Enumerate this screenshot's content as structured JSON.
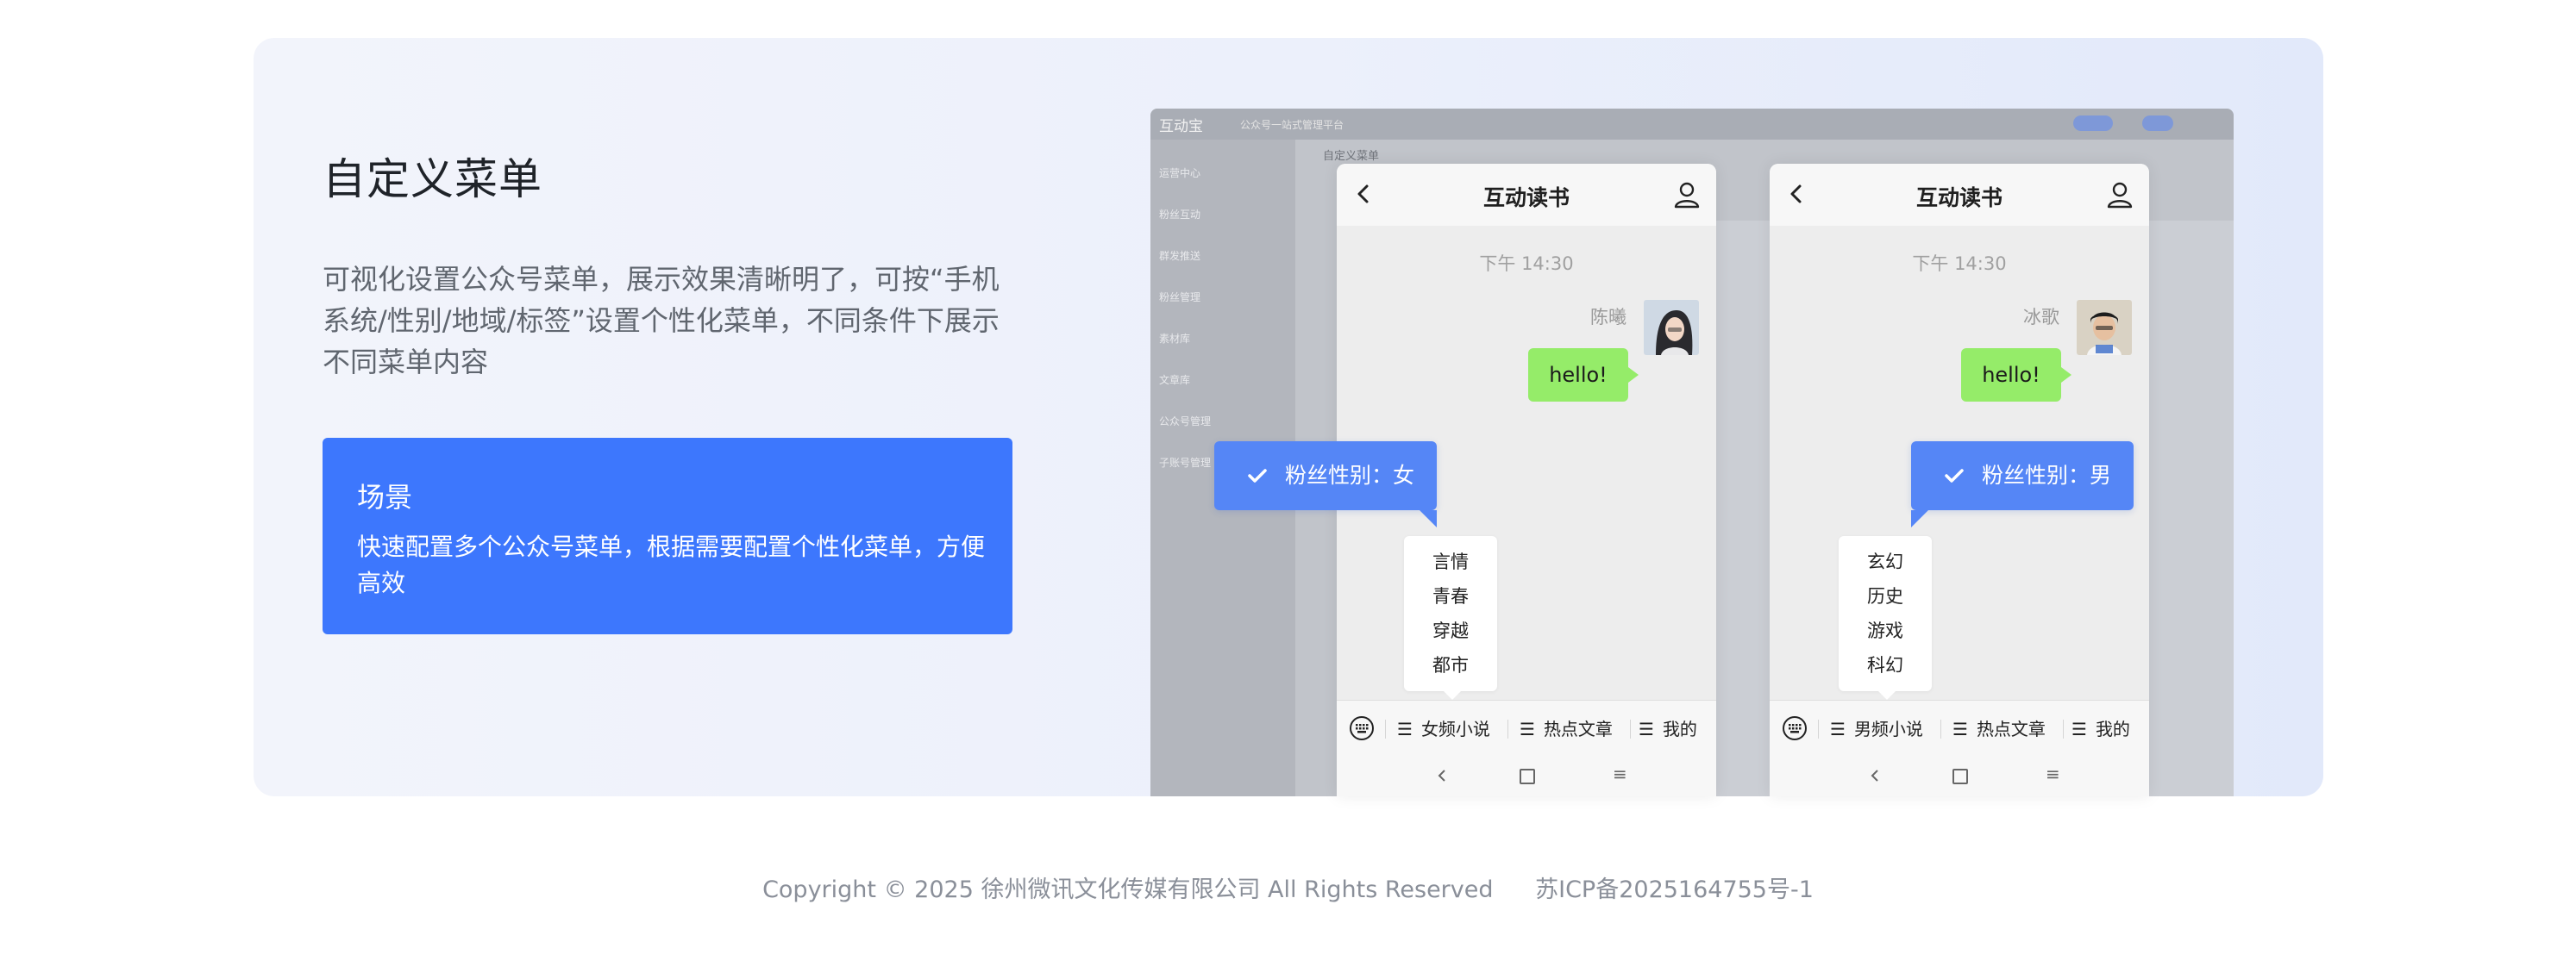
{
  "feature": {
    "title": "自定义菜单",
    "description": "可视化设置公众号菜单，展示效果清晰明了，可按“手机系统/性别/地域/标签”设置个性化菜单，不同条件下展示不同菜单内容",
    "scene": {
      "title": "场景",
      "text": "快速配置多个公众号菜单，根据需要配置个性化菜单，方便高效"
    }
  },
  "admin_bg": {
    "logo": "互动宝",
    "subtitle": "公众号一站式管理平台",
    "page_heading": "自定义菜单",
    "sidebar": [
      "运营中心",
      "粉丝互动",
      "群发推送",
      "粉丝管理",
      "素材库",
      "文章库",
      "公众号管理",
      "子账号管理"
    ]
  },
  "phones": [
    {
      "title": "互动读书",
      "time": "下午 14:30",
      "sender": "陈曦",
      "message": "hello!",
      "tag": "粉丝性别：女",
      "submenu": [
        "言情",
        "青春",
        "穿越",
        "都市"
      ],
      "menu": [
        "女频小说",
        "热点文章",
        "我的"
      ]
    },
    {
      "title": "互动读书",
      "time": "下午 14:30",
      "sender": "冰歌",
      "message": "hello!",
      "tag": "粉丝性别：男",
      "submenu": [
        "玄幻",
        "历史",
        "游戏",
        "科幻"
      ],
      "menu": [
        "男频小说",
        "热点文章",
        "我的"
      ]
    }
  ],
  "footer": {
    "copyright": "Copyright © 2025 徐州微讯文化传媒有限公司 All Rights Reserved",
    "icp": "苏ICP备2025164755号-1"
  },
  "colors": {
    "accent": "#3d77fd",
    "tag": "#5586f6",
    "chat_bubble": "#95ec69"
  }
}
